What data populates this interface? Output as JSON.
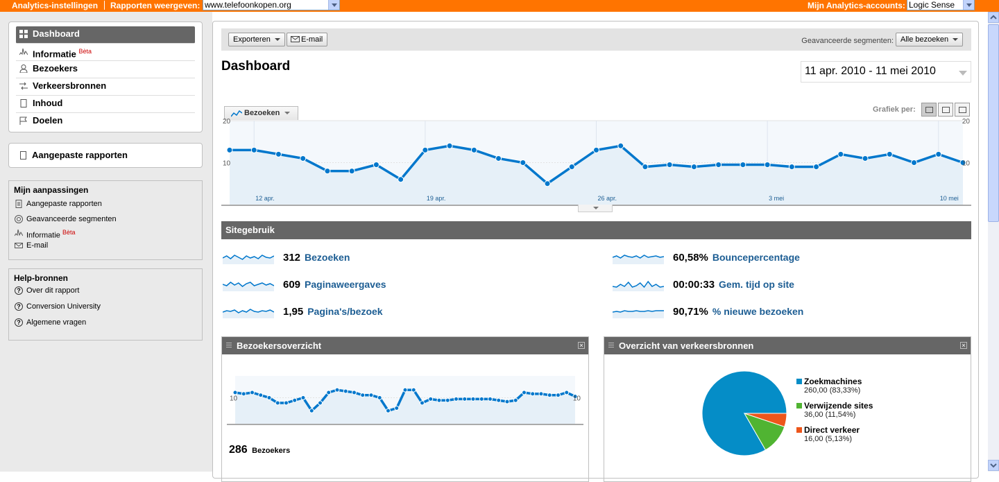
{
  "topbar": {
    "analytics_settings": "Analytics-instellingen",
    "show_reports": "Rapporten weergeven:",
    "site_select": "www.telefoonkopen.org",
    "my_accounts": "Mijn Analytics-accounts:",
    "account_select": "Logic Sense"
  },
  "sidebar": {
    "nav": [
      {
        "label": "Dashboard",
        "icon": "dashboard-icon"
      },
      {
        "label": "Informatie",
        "badge": "Bèta",
        "icon": "sparkline-icon"
      },
      {
        "label": "Bezoekers",
        "icon": "person-icon"
      },
      {
        "label": "Verkeersbronnen",
        "icon": "arrows-icon"
      },
      {
        "label": "Inhoud",
        "icon": "page-icon"
      },
      {
        "label": "Doelen",
        "icon": "flag-icon"
      }
    ],
    "custom_reports": "Aangepaste rapporten",
    "customizations": {
      "title": "Mijn aanpassingen",
      "items": [
        {
          "label": "Aangepaste rapporten"
        },
        {
          "label": "Geavanceerde segmenten"
        },
        {
          "label": "Informatie",
          "badge": "Bèta"
        },
        {
          "label": "E-mail"
        }
      ]
    },
    "help": {
      "title": "Help-bronnen",
      "items": [
        {
          "label": "Over dit rapport"
        },
        {
          "label": "Conversion University"
        },
        {
          "label": "Algemene vragen"
        }
      ]
    }
  },
  "toolbar": {
    "export": "Exporteren",
    "email": "E-mail",
    "segments_label": "Geavanceerde segmenten:",
    "segments_value": "Alle bezoeken"
  },
  "page_title": "Dashboard",
  "date_range": "11 apr. 2010 - 11 mei 2010",
  "graph_tab": "Bezoeken",
  "graph_per": "Grafiek per:",
  "colors": {
    "accent": "#ff7400",
    "line": "#0077cc",
    "fill": "#e6f0f8",
    "pie_search": "#058dc7",
    "pie_referral": "#50b432",
    "pie_direct": "#ed561b"
  },
  "site_usage": {
    "title": "Sitegebruik",
    "metrics": [
      {
        "value": "312",
        "label": "Bezoeken"
      },
      {
        "value": "609",
        "label": "Paginaweergaves"
      },
      {
        "value": "1,95",
        "label": "Pagina's/bezoek"
      },
      {
        "value": "60,58%",
        "label": "Bouncepercentage"
      },
      {
        "value": "00:00:33",
        "label": "Gem. tijd op site"
      },
      {
        "value": "90,71%",
        "label": "% nieuwe bezoeken"
      }
    ]
  },
  "visitors_widget": {
    "title": "Bezoekersoverzicht",
    "total": "286",
    "total_label": "Bezoekers"
  },
  "traffic_widget": {
    "title": "Overzicht van verkeersbronnen"
  },
  "chart_data": [
    {
      "type": "line",
      "series": [
        {
          "values": [
            13,
            13,
            12,
            11,
            8,
            8,
            9.5,
            6,
            13,
            14,
            13,
            11,
            10,
            5,
            9,
            13,
            14,
            9,
            9.5,
            9,
            9.5,
            9.5,
            9.5,
            9,
            9,
            12,
            11,
            12,
            10,
            12,
            10
          ]
        }
      ],
      "xticks": [
        "12 apr.",
        "19 apr.",
        "26 apr.",
        "3 mei",
        "10 mei"
      ],
      "yticks": [
        "10",
        "20"
      ],
      "ylim": [
        0,
        20
      ]
    },
    {
      "type": "line",
      "series": [
        {
          "values": [
            12,
            11.5,
            12,
            11,
            10,
            8,
            8,
            9,
            10,
            5,
            8,
            12,
            13,
            12.5,
            12,
            11,
            11,
            10,
            5,
            6,
            13,
            13,
            8,
            9.5,
            9,
            9,
            9.5,
            9.5,
            9.5,
            9.5,
            9.5,
            9,
            8.5,
            9,
            12,
            11.5,
            11.5,
            11,
            11,
            12,
            10.5
          ]
        }
      ],
      "yticks": [
        "10",
        "20"
      ],
      "ylim": [
        0,
        20
      ]
    },
    {
      "type": "pie",
      "labels": [
        "Zoekmachines",
        "Verwijzende sites",
        "Direct verkeer"
      ],
      "values": [
        260,
        36,
        16
      ],
      "value_labels": [
        "260,00 (83,33%)",
        "36,00 (11,54%)",
        "16,00 (5,13%)"
      ]
    }
  ]
}
